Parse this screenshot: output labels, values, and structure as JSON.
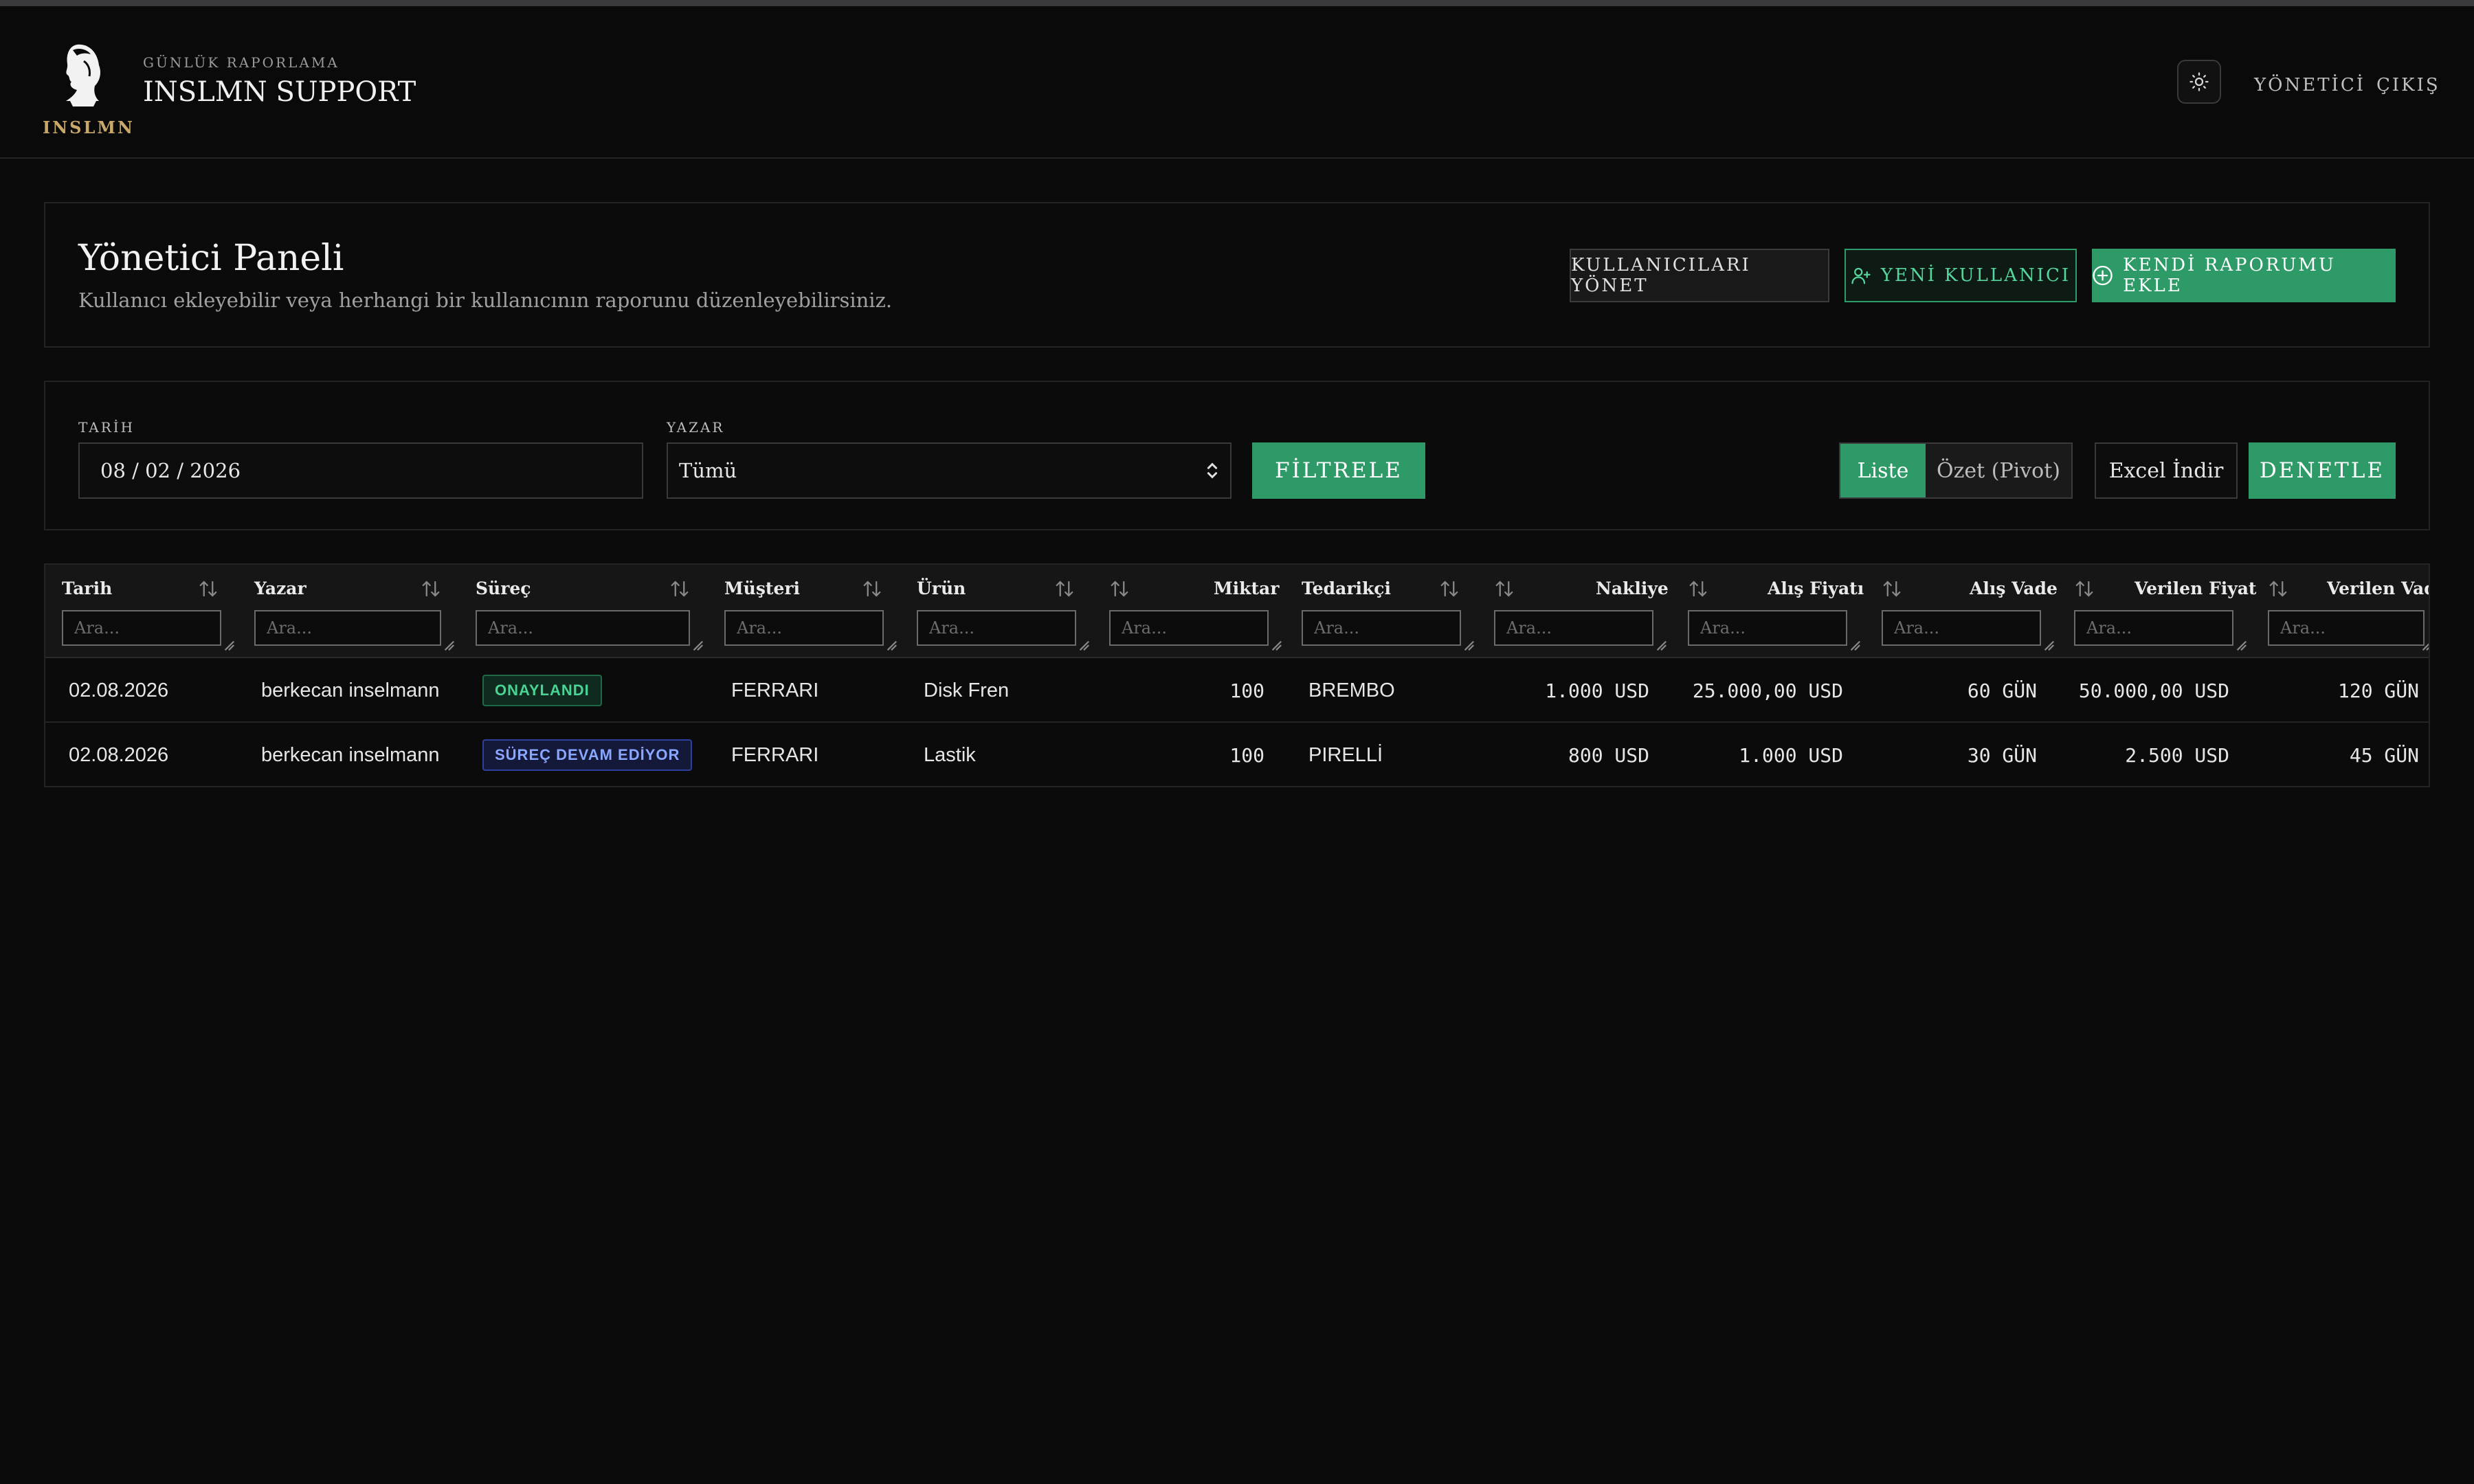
{
  "header": {
    "logo_text": "INSLMN",
    "subtitle": "GÜNLÜK RAPORLAMA",
    "title": "INSLMN SUPPORT",
    "nav_admin": "YÖNETİCİ",
    "nav_logout": "ÇIKIŞ"
  },
  "admin_panel": {
    "title": "Yönetici Paneli",
    "description": "Kullanıcı ekleyebilir veya herhangi bir kullanıcının raporunu düzenleyebilirsiniz.",
    "manage_users_label": "KULLANICILARI YÖNET",
    "new_user_label": "YENİ KULLANICI",
    "add_report_label": "KENDİ RAPORUMU EKLE"
  },
  "filters": {
    "date_label": "TARİH",
    "date_value": "08 / 02 / 2026",
    "author_label": "YAZAR",
    "author_value": "Tümü",
    "filter_button": "FİLTRELE",
    "view_list": "Liste",
    "view_pivot": "Özet (Pivot)",
    "excel_button": "Excel İndir",
    "audit_button": "DENETLE"
  },
  "table": {
    "filter_placeholder": "Ara...",
    "columns": [
      "Tarih",
      "Yazar",
      "Süreç",
      "Müşteri",
      "Ürün",
      "Miktar",
      "Tedarikçi",
      "Nakliye",
      "Alış Fiyatı",
      "Alış Vade",
      "Verilen Fiyat",
      "Verilen Vade"
    ],
    "rows": [
      {
        "date": "02.08.2026",
        "author": "berkecan inselmann",
        "status": "ONAYLANDI",
        "customer": "FERRARI",
        "product": "Disk Fren",
        "quantity": "100",
        "supplier": "BREMBO",
        "shipping": "1.000 USD",
        "buy_price": "25.000,00 USD",
        "buy_term": "60 GÜN",
        "sell_price": "50.000,00 USD",
        "sell_term": "120 GÜN"
      },
      {
        "date": "02.08.2026",
        "author": "berkecan inselmann",
        "status": "SÜREÇ DEVAM EDİYOR",
        "customer": "FERRARI",
        "product": "Lastik",
        "quantity": "100",
        "supplier": "PIRELLİ",
        "shipping": "800 USD",
        "buy_price": "1.000 USD",
        "buy_term": "30 GÜN",
        "sell_price": "2.500 USD",
        "sell_term": "45 GÜN"
      }
    ]
  },
  "colors": {
    "accent_green": "#2e9a67",
    "logo_gold": "#c9a86a",
    "status_approved": "#49d493",
    "status_in_progress": "#8aa6ff"
  },
  "icons": [
    "logo-bust-icon",
    "sun-icon",
    "user-plus-icon",
    "plus-circle-icon",
    "chevron-updown-icon",
    "sort-icon",
    "resize-grip-icon"
  ]
}
